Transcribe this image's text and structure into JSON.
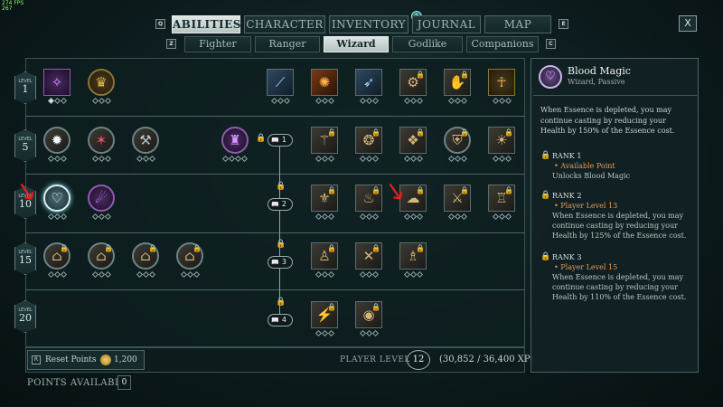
{
  "hud": {
    "fps": "274 FPS",
    "fps2": "267"
  },
  "nav": {
    "prev_key": "Q",
    "next_key": "E",
    "sub_prev_key": "Z",
    "sub_next_key": "C",
    "tabs": [
      "ABILITIES",
      "CHARACTER",
      "INVENTORY",
      "JOURNAL",
      "MAP"
    ],
    "journal_badge": "1",
    "close": "X",
    "subtabs": [
      "Fighter",
      "Ranger",
      "Wizard",
      "Godlike",
      "Companions"
    ]
  },
  "levels": [
    {
      "label": "LEVEL",
      "value": "1"
    },
    {
      "label": "LEVEL",
      "value": "5"
    },
    {
      "label": "LEVEL",
      "value": "10"
    },
    {
      "label": "LEVEL",
      "value": "15"
    },
    {
      "label": "LEVEL",
      "value": "20"
    }
  ],
  "gates": [
    "1",
    "2",
    "3",
    "4"
  ],
  "bottom": {
    "reset_key": "R",
    "reset_label": "Reset Points",
    "reset_cost": "1,200",
    "player_level_label": "PLAYER LEVEL",
    "player_level": "12",
    "xp": "(30,852 / 36,400 XP)",
    "points_label": "POINTS AVAILABLE",
    "points_value": "0"
  },
  "detail": {
    "icon": "blood-magic-icon",
    "title": "Blood Magic",
    "subtitle": "Wizard, Passive",
    "description": "When Essence is depleted, you may continue casting by reducing your Health by 150% of the Essence cost.",
    "ranks": [
      {
        "title": "RANK 1",
        "req": "• Available Point",
        "desc": "Unlocks Blood Magic"
      },
      {
        "title": "RANK 2",
        "req": "• Player Level 13",
        "desc": "When Essence is depleted, you may continue casting by reducing your Health by 125% of the Essence cost."
      },
      {
        "title": "RANK 3",
        "req": "• Player Level 15",
        "desc": "When Essence is depleted, you may continue casting by reducing your Health by 110% of the Essence cost."
      }
    ]
  }
}
